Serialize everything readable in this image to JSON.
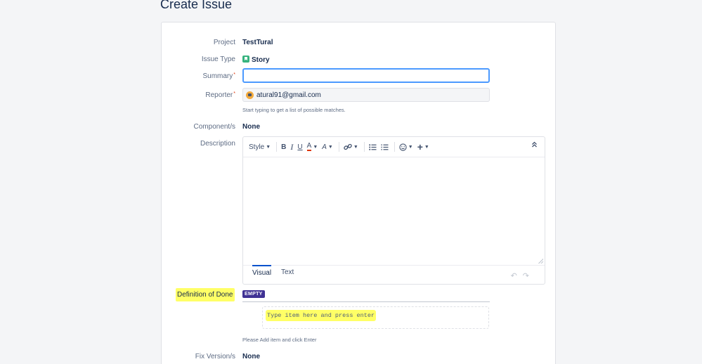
{
  "page": {
    "title": "Create Issue"
  },
  "fields": {
    "project": {
      "label": "Project",
      "value": "TestTural"
    },
    "issue_type": {
      "label": "Issue Type",
      "value": "Story",
      "icon": "story-icon"
    },
    "summary": {
      "label": "Summary",
      "required_mark": "*",
      "value": ""
    },
    "reporter": {
      "label": "Reporter",
      "required_mark": "*",
      "value": "atural91@gmail.com",
      "hint": "Start typing to get a list of possible matches."
    },
    "components": {
      "label": "Component/s",
      "value": "None"
    },
    "description": {
      "label": "Description",
      "toolbar": {
        "style_label": "Style",
        "bold": "B",
        "italic": "I",
        "underline": "U",
        "text_color": "A",
        "more_format": "A",
        "icons": [
          "chevron-down-icon",
          "link-icon",
          "bullet-list-icon",
          "numbered-list-icon",
          "emoji-icon",
          "plus-icon",
          "collapse-icon"
        ]
      },
      "tabs": [
        "Visual",
        "Text"
      ],
      "active_tab": "Visual"
    },
    "definition_of_done": {
      "label": "Definition of Done",
      "badge": "EMPTY",
      "placeholder": "Type item here and press enter",
      "hint": "Please Add item and click Enter"
    },
    "fix_versions": {
      "label": "Fix Version/s",
      "value": "None"
    }
  },
  "colors": {
    "accent": "#0052cc",
    "focus": "#4c9aff",
    "highlight": "#ffff66",
    "badge": "#403294",
    "story": "#36b37e"
  }
}
